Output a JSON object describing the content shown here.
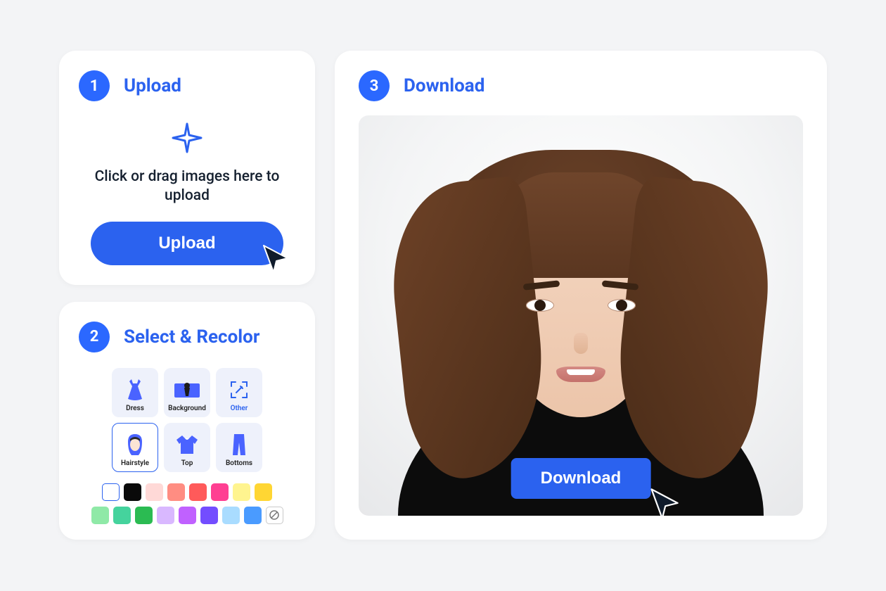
{
  "colors": {
    "accent": "#2b62ef",
    "badge_bg": "#2b68ff"
  },
  "step1": {
    "number": "1",
    "title": "Upload",
    "hint": "Click or drag images here to upload",
    "button_label": "Upload"
  },
  "step2": {
    "number": "2",
    "title": "Select & Recolor",
    "categories": [
      {
        "id": "dress",
        "label": "Dress"
      },
      {
        "id": "background",
        "label": "Background"
      },
      {
        "id": "other",
        "label": "Other"
      },
      {
        "id": "hairstyle",
        "label": "Hairstyle",
        "selected": true
      },
      {
        "id": "top",
        "label": "Top"
      },
      {
        "id": "bottoms",
        "label": "Bottoms"
      }
    ],
    "swatches_row1": [
      {
        "color": "#ffffff",
        "outline": true
      },
      {
        "color": "#0a0a0a"
      },
      {
        "color": "#ffd9d7"
      },
      {
        "color": "#ff8d82"
      },
      {
        "color": "#ff5a5a"
      },
      {
        "color": "#ff3f92"
      },
      {
        "color": "#fff48f"
      },
      {
        "color": "#ffd633"
      }
    ],
    "swatches_row2": [
      {
        "color": "#8fe9a7"
      },
      {
        "color": "#45d39d"
      },
      {
        "color": "#2bbb52"
      },
      {
        "color": "#d9b8ff"
      },
      {
        "color": "#c061ff"
      },
      {
        "color": "#734dff"
      },
      {
        "color": "#a9dcff"
      },
      {
        "color": "#4a9bff"
      },
      {
        "color": "none"
      }
    ]
  },
  "step3": {
    "number": "3",
    "title": "Download",
    "button_label": "Download"
  }
}
